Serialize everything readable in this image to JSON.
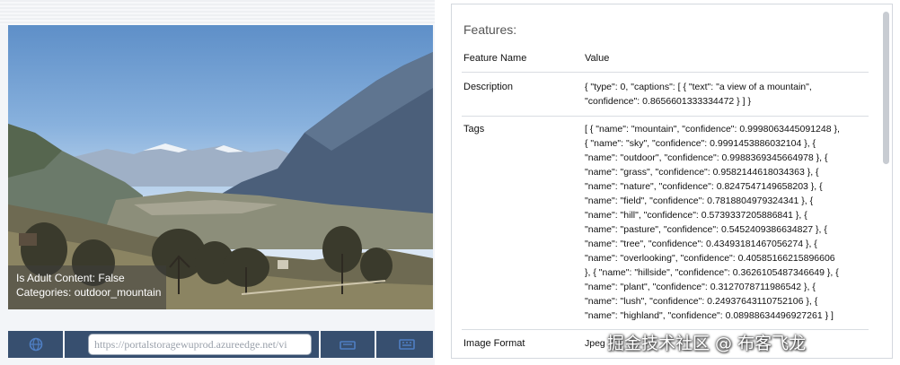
{
  "image_panel": {
    "is_adult_content": "Is Adult Content: False",
    "categories": "Categories: outdoor_mountain"
  },
  "toolbar": {
    "url": "https://portalstoragewuprod.azureedge.net/vi",
    "icons": [
      "globe-icon",
      "image-icon",
      "keyboard-icon",
      "keyboard-icon"
    ]
  },
  "features": {
    "title": "Features:",
    "col_name": "Feature Name",
    "col_value": "Value",
    "rows": [
      {
        "name": "Description",
        "value": "{ \"type\": 0, \"captions\": [ { \"text\": \"a view of a mountain\",\n\"confidence\": 0.8656601333334472 } ] }"
      },
      {
        "name": "Tags",
        "value": "[ { \"name\": \"mountain\", \"confidence\": 0.9998063445091248 },\n{ \"name\": \"sky\", \"confidence\": 0.9991453886032104 }, {\n\"name\": \"outdoor\", \"confidence\": 0.9988369345664978 }, {\n\"name\": \"grass\", \"confidence\": 0.9582144618034363 }, {\n\"name\": \"nature\", \"confidence\": 0.8247547149658203 }, {\n\"name\": \"field\", \"confidence\": 0.7818804979324341 }, {\n\"name\": \"hill\", \"confidence\": 0.5739337205886841 }, {\n\"name\": \"pasture\", \"confidence\": 0.5452409386634827 }, {\n\"name\": \"tree\", \"confidence\": 0.43493181467056274 }, {\n\"name\": \"overlooking\", \"confidence\": 0.40585166215896606\n}, { \"name\": \"hillside\", \"confidence\": 0.3626105487346649 }, {\n\"name\": \"plant\", \"confidence\": 0.3127078711986542 }, {\n\"name\": \"lush\", \"confidence\": 0.24937643110752106 }, {\n\"name\": \"highland\", \"confidence\": 0.08988634496927261 } ]"
      },
      {
        "name": "Image Format",
        "value": "Jpeg"
      }
    ]
  },
  "watermark": "掘金技术社区 @ 布客飞龙",
  "colors": {
    "toolbar_bg": "#374f6f",
    "toolbar_icon": "#4f7fc4",
    "panel_border": "#d4d8de"
  }
}
